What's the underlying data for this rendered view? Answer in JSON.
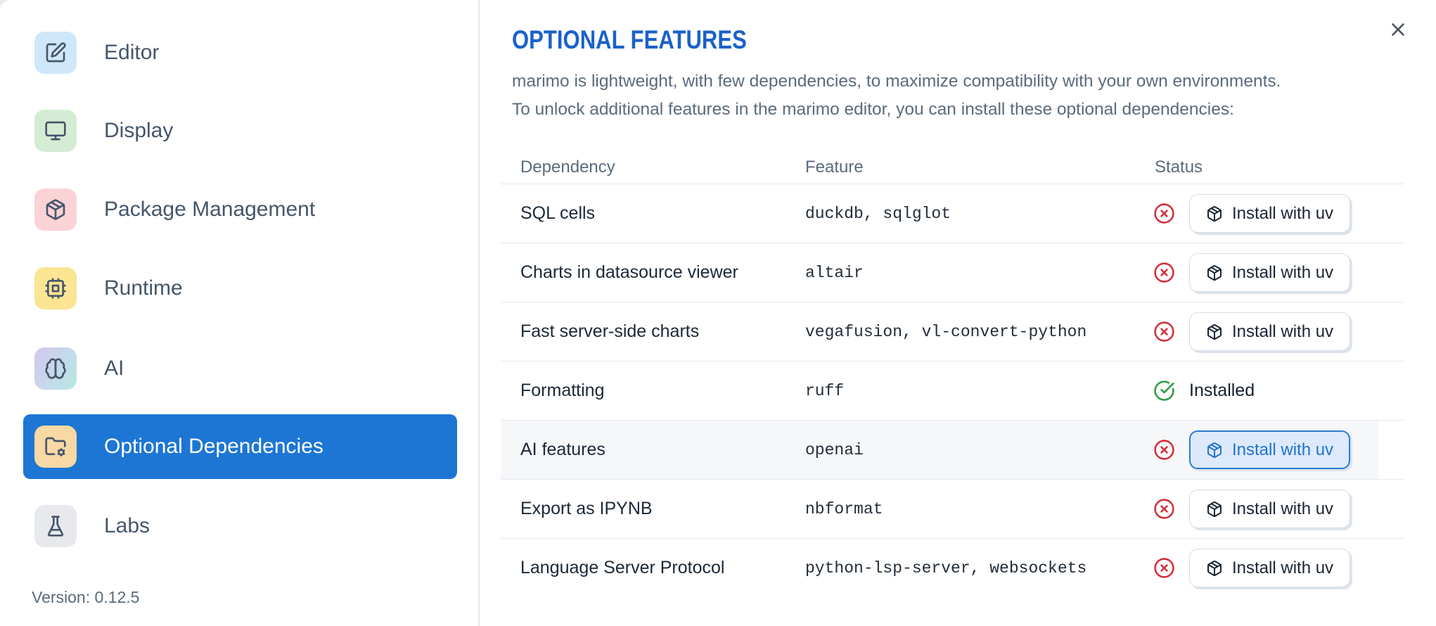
{
  "sidebar": {
    "items": [
      {
        "label": "Editor",
        "icon": "square-pen-icon",
        "icon_bg": "#cfe7fa",
        "selected": false
      },
      {
        "label": "Display",
        "icon": "monitor-icon",
        "icon_bg": "#d5ecd4",
        "selected": false
      },
      {
        "label": "Package Management",
        "icon": "package-icon",
        "icon_bg": "#fbd3d7",
        "selected": false
      },
      {
        "label": "Runtime",
        "icon": "cpu-icon",
        "icon_bg": "#fbe492",
        "selected": false
      },
      {
        "label": "AI",
        "icon": "brain-icon",
        "icon_bg": "linear-gradient purple-teal",
        "selected": false
      },
      {
        "label": "Optional Dependencies",
        "icon": "folder-cog-icon",
        "icon_bg": "#f8d8a4",
        "selected": true
      },
      {
        "label": "Labs",
        "icon": "flask-icon",
        "icon_bg": "#e8e9ed",
        "selected": false
      }
    ],
    "version_label": "Version: 0.12.5"
  },
  "panel": {
    "title": "OPTIONAL FEATURES",
    "description_line1": "marimo is lightweight, with few dependencies, to maximize compatibility with your own environments.",
    "description_line2": "To unlock additional features in the marimo editor, you can install these optional dependencies:",
    "close_icon": "x-icon",
    "table": {
      "headers": [
        "Dependency",
        "Feature",
        "Status"
      ],
      "rows": [
        {
          "dependency": "SQL cells",
          "feature": "duckdb, sqlglot",
          "installed": false,
          "status_icon": "circle-x-icon",
          "action": "Install with uv"
        },
        {
          "dependency": "Charts in datasource viewer",
          "feature": "altair",
          "installed": false,
          "status_icon": "circle-x-icon",
          "action": "Install with uv"
        },
        {
          "dependency": "Fast server-side charts",
          "feature": "vegafusion, vl-convert-python",
          "installed": false,
          "status_icon": "circle-x-icon",
          "action": "Install with uv"
        },
        {
          "dependency": "Formatting",
          "feature": "ruff",
          "installed": true,
          "status_icon": "circle-check-icon",
          "status_label": "Installed"
        },
        {
          "dependency": "AI features",
          "feature": "openai",
          "installed": false,
          "status_icon": "circle-x-icon",
          "action": "Install with uv",
          "highlighted": true
        },
        {
          "dependency": "Export as IPYNB",
          "feature": "nbformat",
          "installed": false,
          "status_icon": "circle-x-icon",
          "action": "Install with uv"
        },
        {
          "dependency": "Language Server Protocol",
          "feature": "python-lsp-server, websockets",
          "installed": false,
          "status_icon": "circle-x-icon",
          "action": "Install with uv"
        }
      ]
    }
  },
  "colors": {
    "selected_item_bg": "#1d76d3",
    "title_blue": "#1a61c9",
    "error_red": "#d3303a",
    "success_green": "#2f9e44",
    "focused_button_border": "#2b7cd6",
    "focused_button_bg": "#dceafb",
    "row_hover_bg": "#f6f7f9"
  }
}
